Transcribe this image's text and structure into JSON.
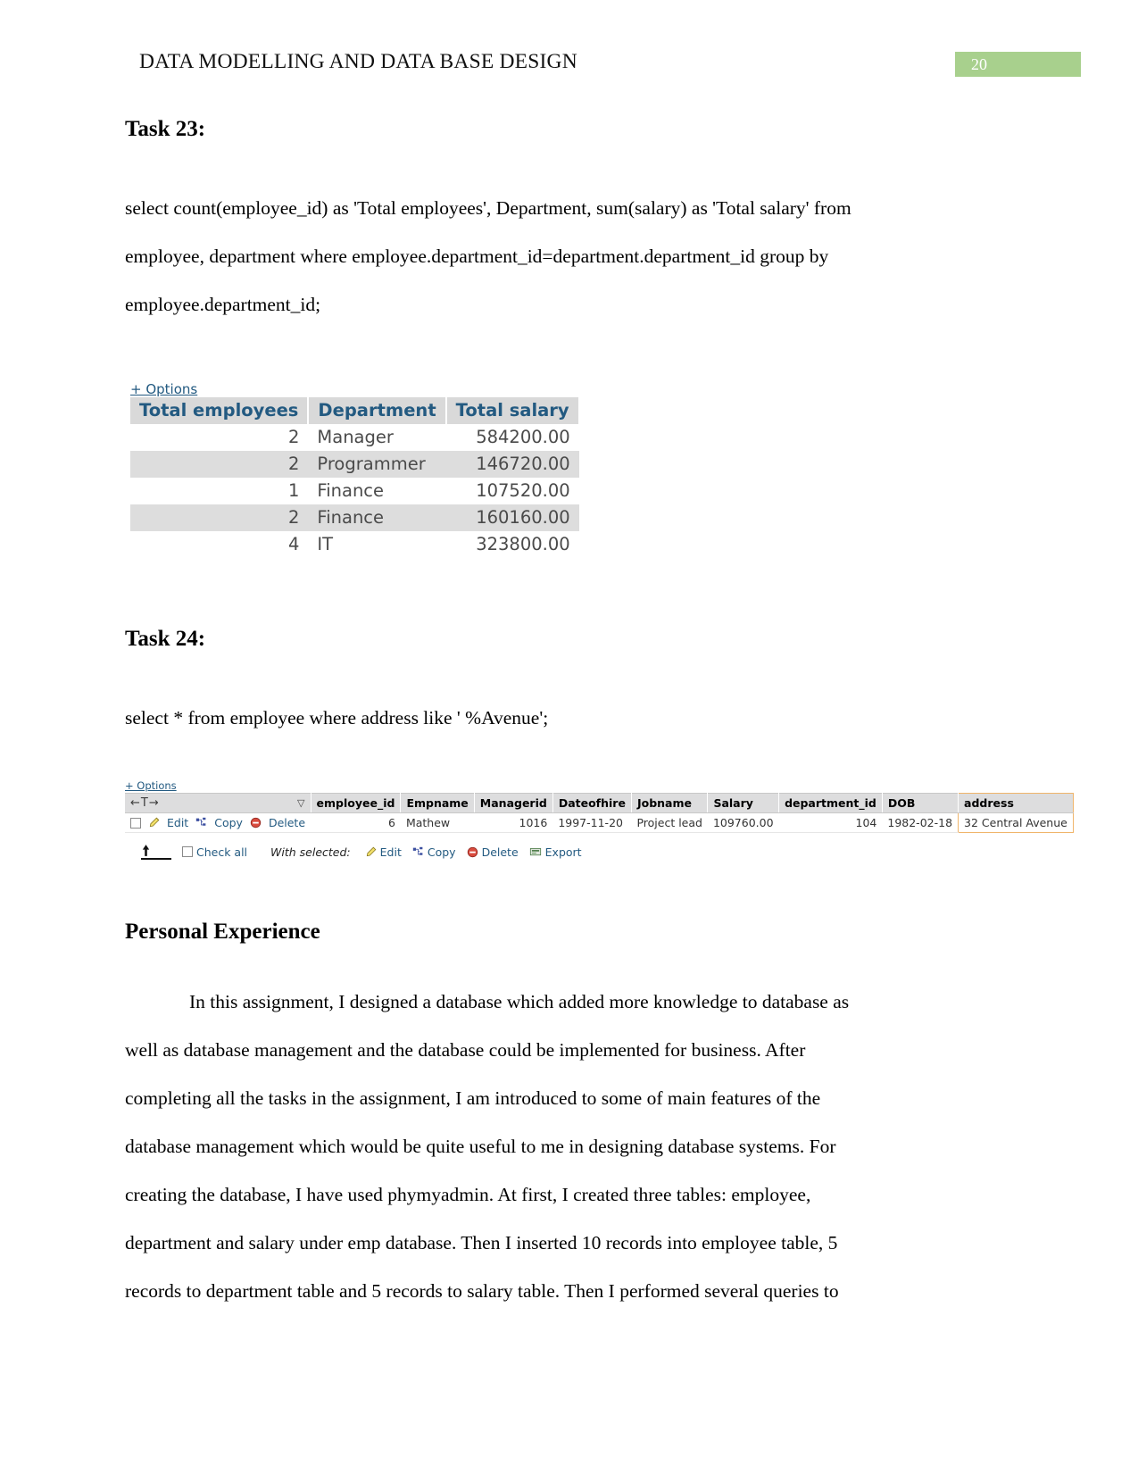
{
  "header": {
    "title": "DATA MODELLING AND DATA BASE DESIGN",
    "page_number": "20",
    "badge_color": "#a8d08d"
  },
  "task23": {
    "heading": "Task 23:",
    "query_line1": "select count(employee_id) as 'Total employees', Department, sum(salary) as 'Total salary' from",
    "query_line2": "employee, department where employee.department_id=department.department_id group by",
    "query_line3": "employee.department_id;",
    "result": {
      "options_label": "+ Options",
      "columns": [
        "Total employees",
        "Department",
        "Total salary"
      ],
      "rows": [
        [
          "2",
          "Manager",
          "584200.00"
        ],
        [
          "2",
          "Programmer",
          "146720.00"
        ],
        [
          "1",
          "Finance",
          "107520.00"
        ],
        [
          "2",
          "Finance",
          "160160.00"
        ],
        [
          "4",
          "IT",
          "323800.00"
        ]
      ]
    }
  },
  "task24": {
    "heading": "Task 24:",
    "query_line1": "select * from employee where address like ' %Avenue';",
    "result": {
      "options_label": "+ Options",
      "nav_arrows": "←T→",
      "sort_caret": "▽",
      "columns": [
        "employee_id",
        "Empname",
        "Managerid",
        "Dateofhire",
        "Jobname",
        "Salary",
        "department_id",
        "DOB",
        "address"
      ],
      "row_actions": [
        "Edit",
        "Copy",
        "Delete"
      ],
      "rows": [
        {
          "employee_id": "6",
          "Empname": "Mathew",
          "Managerid": "1016",
          "Dateofhire": "1997-11-20",
          "Jobname": "Project lead",
          "Salary": "109760.00",
          "department_id": "104",
          "DOB": "1982-02-18",
          "address": "32 Central Avenue"
        }
      ],
      "footer": {
        "check_all": "Check all",
        "with_selected": "With selected:",
        "actions": [
          "Edit",
          "Copy",
          "Delete",
          "Export"
        ]
      }
    }
  },
  "personal_experience": {
    "heading": "Personal Experience",
    "paragraph_lines": [
      "In this assignment, I designed a database which added more knowledge to database as",
      "well as database management and the database could be implemented for business. After",
      "completing all the tasks in the assignment, I am introduced to some of main features of the",
      "database management which would be quite useful to me in designing database systems. For",
      "creating the database, I have used phymyadmin. At first, I created three tables: employee,",
      "department and salary under emp database. Then I inserted 10 records into employee table, 5",
      "records to department table and 5 records to salary table. Then I performed several queries to"
    ]
  }
}
